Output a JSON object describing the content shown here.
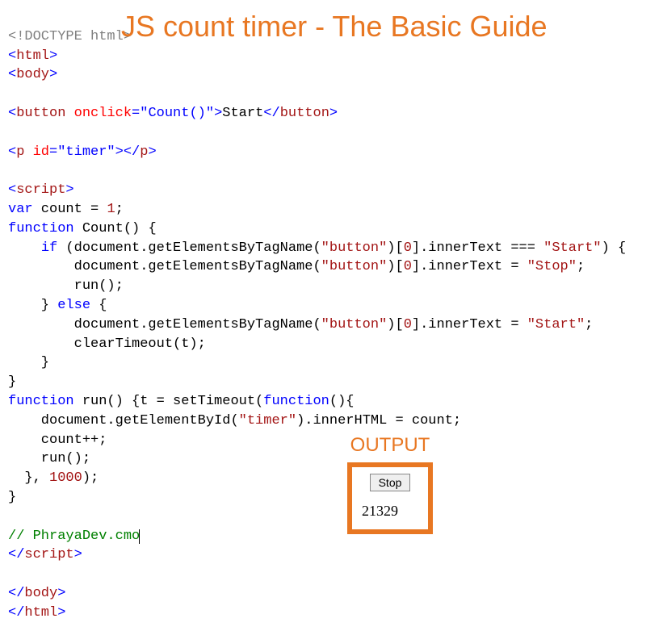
{
  "title": "JS count timer - The Basic Guide",
  "code": {
    "doctype": "<!DOCTYPE html>",
    "tag_html_open": "html",
    "tag_body_open": "body",
    "tag_button": "button",
    "attr_onclick": "onclick",
    "onclick_val": "\"Count()\"",
    "btn_text": "Start",
    "tag_p": "p",
    "attr_id": "id",
    "id_val": "\"timer\"",
    "tag_script": "script",
    "kw_var": "var",
    "var_line": " count = ",
    "num_1": "1",
    "semi": ";",
    "kw_function": "function",
    "fn_count_sig": " Count() {",
    "kw_if": "if",
    "if_cond_a": " (document.getElementsByTagName(",
    "str_button": "\"button\"",
    "if_cond_b": ")[",
    "num_0": "0",
    "if_cond_c": "].innerText === ",
    "str_start": "\"Start\"",
    "if_cond_d": ") {",
    "assign_a": "        document.getElementsByTagName(",
    "assign_b": ")[",
    "assign_c": "].innerText = ",
    "str_stop": "\"Stop\"",
    "run_call": "        run();",
    "brace_close_else": "    } ",
    "kw_else": "else",
    "else_open": " {",
    "clear_call": "        clearTimeout(t);",
    "brace4": "    }",
    "brace_close": "}",
    "fn_run_sig": " run() {t = setTimeout(",
    "anon_open": "(){",
    "run_body1a": "    document.getElementById(",
    "str_timer": "\"timer\"",
    "run_body1b": ").innerHTML = count;",
    "run_body2": "    count++;",
    "run_body3": "    run();",
    "run_close_a": "  }, ",
    "num_1000": "1000",
    "run_close_b": ");",
    "comment": "// PhrayaDev.cmo",
    "lt": "<",
    "gt": ">",
    "sl": "/",
    "eq": "="
  },
  "output": {
    "label": "OUTPUT",
    "button": "Stop",
    "value": "21329"
  }
}
